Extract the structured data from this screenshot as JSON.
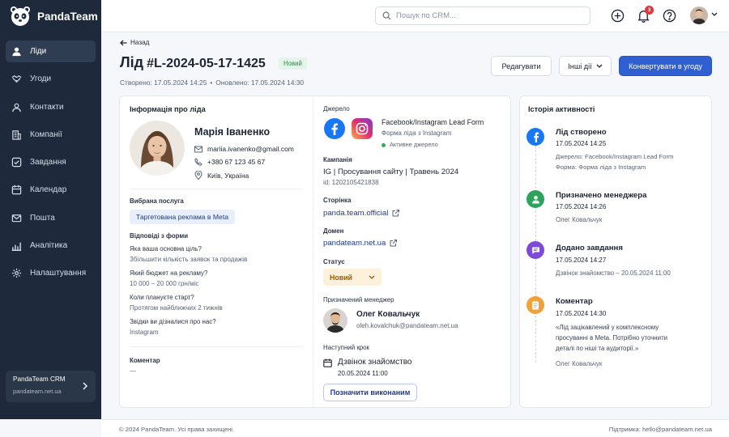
{
  "brand": {
    "name": "PandaTeam"
  },
  "sidebar": {
    "items": [
      {
        "label": "Ліди",
        "icon": "user-icon"
      },
      {
        "label": "Угоди",
        "icon": "handshake-icon"
      },
      {
        "label": "Контакти",
        "icon": "contacts-icon"
      },
      {
        "label": "Компанії",
        "icon": "building-icon"
      },
      {
        "label": "Завдання",
        "icon": "checkbox-icon"
      },
      {
        "label": "Календар",
        "icon": "calendar-icon"
      },
      {
        "label": "Пошта",
        "icon": "mail-icon"
      },
      {
        "label": "Аналітика",
        "icon": "bar-chart-icon"
      },
      {
        "label": "Налаштування",
        "icon": "gear-icon"
      }
    ],
    "active_index": 0,
    "footer": {
      "title": "PandaTeam CRM",
      "domain": "pandateam.net.ua"
    }
  },
  "topbar": {
    "search_placeholder": "Пошук по CRM...",
    "notifications_count": "3"
  },
  "page": {
    "back_label": "Назад",
    "title_prefix": "Лід",
    "lead_id": "#L-2024-05-17-1425",
    "status_badge": "Новий",
    "created": "Створено: 17.05.2024 14:25",
    "updated": "Оновлено: 17.05.2024 14:30",
    "separator": "•",
    "buttons": {
      "edit": "Редагувати",
      "more": "Інші дії",
      "convert": "Конвертувати в угоду"
    }
  },
  "lead_info": {
    "section_title": "Інформація про ліда",
    "name": "Марія Іваненко",
    "email": "mariia.ivanenko@gmail.com",
    "phone": "+380 67 123 45 67",
    "location": "Київ, Україна",
    "service_label": "Вибрана послуга",
    "service_value": "Таргетована реклама в Meta",
    "form_answers_label": "Відповіді з форми",
    "answers": [
      {
        "q": "Яка ваша основна ціль?",
        "a": "Збільшити кількість заявок та продажів"
      },
      {
        "q": "Який бюджет на рекламу?",
        "a": "10 000 – 20 000 грн/міс"
      },
      {
        "q": "Коли плануєте старт?",
        "a": "Протягом найближчих 2 тижнів"
      },
      {
        "q": "Звідки ви дізналися про нас?",
        "a": "Instagram"
      }
    ],
    "comment_label": "Коментар",
    "comment_value": "—"
  },
  "details": {
    "source_label": "Джерело",
    "source_title": "Facebook/Instagram Lead Form",
    "source_form": "Форма ліда з Instagram",
    "source_status": "Активне джерело",
    "campaign_label": "Кампанія",
    "campaign_value": "IG | Просування сайту | Травень 2024",
    "campaign_id": "id: 1202105421838",
    "page_label": "Сторінка",
    "page_value": "panda.team.official",
    "domain_label": "Домен",
    "domain_value": "pandateam.net.ua",
    "status_label": "Статус",
    "status_value": "Новий",
    "manager_label": "Призначений менеджер",
    "manager_name": "Олег Ковальчук",
    "manager_email": "oleh.kovalchuk@pandateam.net.ua",
    "next_step_label": "Наступний крок",
    "next_step_title": "Дзвінок знайомство",
    "next_step_date": "20.05.2024 11:00",
    "mark_done": "Позначити виконаним"
  },
  "activity": {
    "section_title": "Історія активності",
    "items": [
      {
        "title": "Лід створено",
        "time": "17.05.2024 14:25",
        "lines": [
          "Джерело: Facebook/Instagram Lead Form",
          "Форма: Форма ліда з Instagram"
        ],
        "icon": "facebook-icon",
        "color": "#1877f2"
      },
      {
        "title": "Призначено менеджера",
        "time": "17.05.2024 14:26",
        "lines": [
          "Олег Ковальчук"
        ],
        "icon": "user-icon",
        "color": "#2ea35c"
      },
      {
        "title": "Додано завдання",
        "time": "17.05.2024 14:27",
        "lines": [
          "Дзвінок знайомство – 20.05.2024 11:00"
        ],
        "icon": "chat-icon",
        "color": "#7c4ad6"
      },
      {
        "title": "Коментар",
        "time": "17.05.2024 14:30",
        "lines": [
          "«Лід зацікавлений у комплексному",
          "просуванні в Meta. Потрібно уточнити",
          "деталі по ніші та аудиторії.»",
          "Олег Ковальчук"
        ],
        "icon": "note-icon",
        "color": "#f0a13a"
      }
    ]
  },
  "footer": {
    "copyright": "© 2024 PandaTeam. Усі права захищені.",
    "support": "Підтримка: hello@pandateam.net.ua"
  }
}
